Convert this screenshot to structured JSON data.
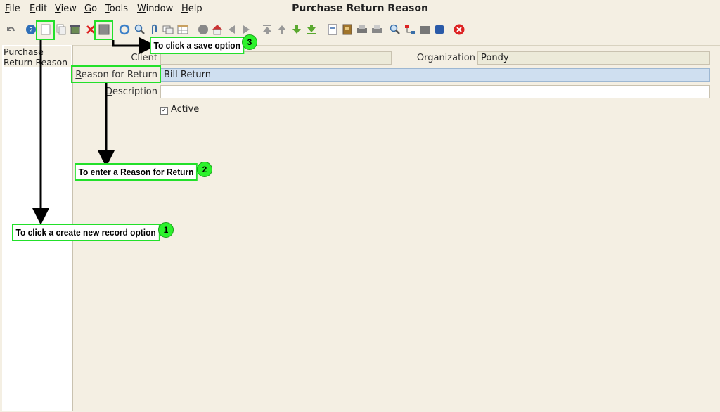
{
  "window": {
    "title": "Purchase Return Reason"
  },
  "menu": [
    {
      "label": "File",
      "key": "F",
      "rest": "ile"
    },
    {
      "label": "Edit",
      "key": "E",
      "rest": "dit"
    },
    {
      "label": "View",
      "key": "V",
      "rest": "iew"
    },
    {
      "label": "Go",
      "key": "G",
      "rest": "o"
    },
    {
      "label": "Tools",
      "key": "T",
      "rest": "ools"
    },
    {
      "label": "Window",
      "key": "W",
      "rest": "indow"
    },
    {
      "label": "Help",
      "key": "H",
      "rest": "elp"
    }
  ],
  "tree": {
    "item": "Purchase Return Reason"
  },
  "form": {
    "client_label": "Client",
    "client_value": "",
    "organization_label": "Organization",
    "organization_value": "Pondy",
    "reason_label_key": "R",
    "reason_label_rest": "eason for Return",
    "reason_value": "Bill Return",
    "description_label_key": "D",
    "description_label_rest": "escription",
    "description_value": "",
    "active_label": "Active",
    "active_checked": true
  },
  "annotations": {
    "step1": {
      "text": "To click a create new record option",
      "number": "1"
    },
    "step2": {
      "text": "To enter a Reason for Return",
      "number": "2"
    },
    "step3": {
      "text": "To click a save option",
      "number": "3"
    }
  },
  "colors": {
    "highlight": "#22e02a",
    "mandatory_field": "#cfdff0",
    "background": "#f4efe3"
  }
}
